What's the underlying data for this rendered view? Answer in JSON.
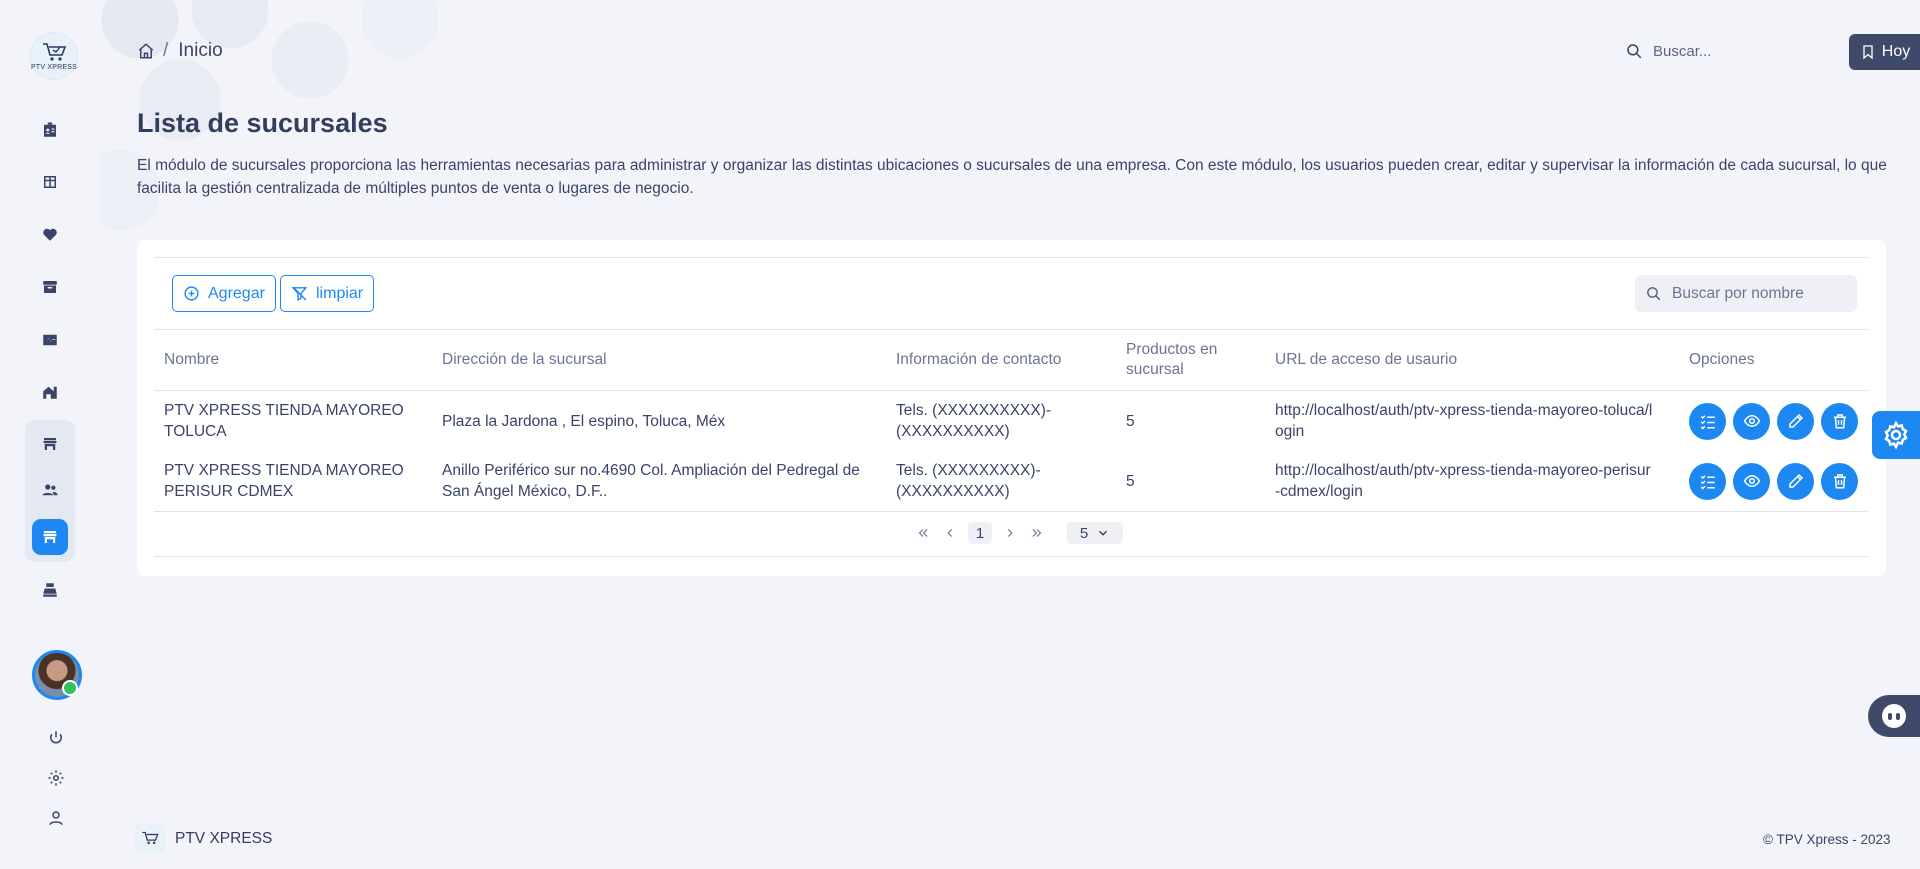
{
  "app": {
    "logo_text": "PTV XPRESS"
  },
  "header": {
    "breadcrumb_current": "Inicio",
    "breadcrumb_separator": "/",
    "search_placeholder": "Buscar...",
    "today_button": "Hoy"
  },
  "page": {
    "title": "Lista de sucursales",
    "description": "El módulo de sucursales proporciona las herramientas necesarias para administrar y organizar las distintas ubicaciones o sucursales de una empresa. Con este módulo, los usuarios pueden crear, editar y supervisar la información de cada sucursal, lo que facilita la gestión centralizada de múltiples puntos de venta o lugares de negocio."
  },
  "toolbar": {
    "add_label": "Agregar",
    "clear_label": "limpiar",
    "search_placeholder": "Buscar por nombre"
  },
  "table": {
    "headers": {
      "name": "Nombre",
      "address": "Dirección de la sucursal",
      "contact": "Información de contacto",
      "products": "Productos en sucursal",
      "url": "URL de acceso de usaurio",
      "options": "Opciones"
    },
    "rows": [
      {
        "name": "PTV XPRESS TIENDA MAYOREO TOLUCA",
        "address": "Plaza la Jardona , El espino, Toluca, Méx",
        "contact": "Tels. (XXXXXXXXXX)-(XXXXXXXXXX)",
        "products": "5",
        "url": "http://localhost/auth/ptv-xpress-tienda-mayoreo-toluca/login"
      },
      {
        "name": "PTV XPRESS TIENDA MAYOREO PERISUR CDMEX",
        "address": "Anillo Periférico sur no.4690 Col. Ampliación del Pedregal de San Ángel México, D.F..",
        "contact": "Tels. (XXXXXXXXX)-(XXXXXXXXXX)",
        "products": "5",
        "url": "http://localhost/auth/ptv-xpress-tienda-mayoreo-perisur-cdmex/login"
      }
    ]
  },
  "pagination": {
    "current_page": "1",
    "page_size": "5"
  },
  "footer": {
    "brand": "PTV XPRESS",
    "copyright": "© TPV Xpress - 2023"
  },
  "colors": {
    "accent": "#1e88f2",
    "background": "#f2f4f9",
    "dark_button": "#3f4a6b",
    "online_status": "#2ec45a"
  },
  "icons": {
    "sidebar": [
      "id-badge-icon",
      "dashboard-icon",
      "heart-icon",
      "archive-icon",
      "monitor-heart-icon",
      "buildings-icon",
      "store-icon",
      "users-icon",
      "store-active-icon",
      "cash-register-icon"
    ],
    "row_actions": [
      "checklist-icon",
      "eye-icon",
      "edit-icon",
      "trash-icon"
    ]
  }
}
